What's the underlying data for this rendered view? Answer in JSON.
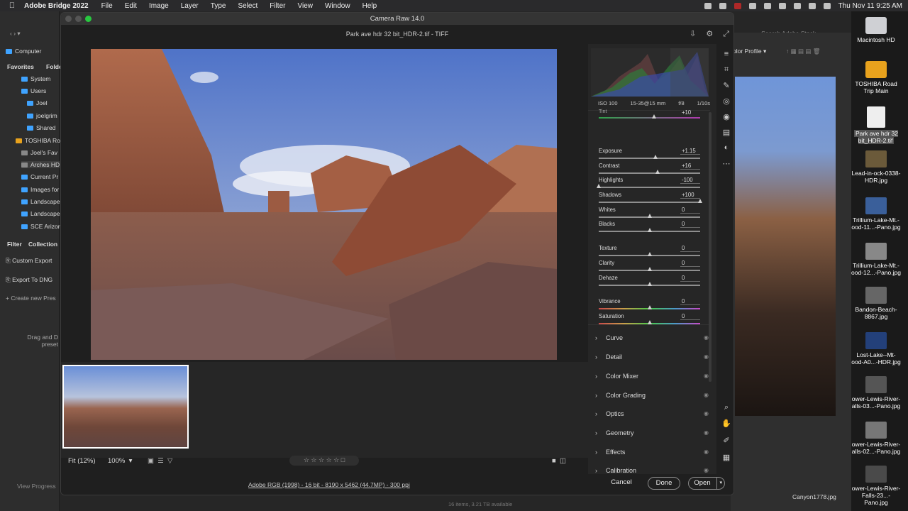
{
  "menubar": {
    "apple": "",
    "app": "Adobe Bridge 2022",
    "items": [
      "File",
      "Edit",
      "Image",
      "Layer",
      "Type",
      "Select",
      "Filter",
      "View",
      "Window",
      "Help"
    ],
    "clock": "Thu Nov 11  9:25 AM"
  },
  "bridge": {
    "path": "Computer",
    "tabs": [
      "Favorites",
      "Folde"
    ],
    "tree": [
      "System",
      "Users",
      "Joel",
      "joelgrim",
      "Shared",
      "TOSHIBA Roa",
      "Joel's Fav",
      "Arches HD",
      "Current Pr",
      "Images for",
      "Landscape",
      "Landscape",
      "SCE Arizor"
    ],
    "bottom_tabs": [
      "Filter",
      "Collection"
    ],
    "export_items": [
      "Custom Export",
      "Export To DNG"
    ],
    "create_preset": "Create new Pres",
    "drag_hint": "Drag and D\npreset",
    "view_progress": "View Progress",
    "search_placeholder": "Search Adobe Stock",
    "color_profile": "olor Profile",
    "status": "16 items, 3.21 TB available",
    "canyon_file": "Canyon1778.jpg"
  },
  "desktop": {
    "icons": [
      {
        "label": "Macintosh HD"
      },
      {
        "label": "TOSHIBA Road Trip Main"
      },
      {
        "label": "Park ave hdr 32 bit_HDR-2.tif"
      },
      {
        "label": "Lead-in-ock-0338-HDR.jpg"
      },
      {
        "label": "Trillium-Lake-Mt.-ood-11...-Pano.jpg"
      },
      {
        "label": "Trillium-Lake-Mt.-ood-12...-Pano.jpg"
      },
      {
        "label": "Bandon-Beach-8867.jpg"
      },
      {
        "label": "Lost-Lake--Mt-ood-A0...-HDR.jpg"
      },
      {
        "label": "ower-Lewis-River-alls-03...-Pano.jpg"
      },
      {
        "label": "ower-Lewis-River-alls-02...-Pano.jpg"
      },
      {
        "label": "ower-Lewis-River-Falls-23...-Pano.jpg"
      }
    ]
  },
  "acr": {
    "window_title": "Camera Raw 14.0",
    "file_title": "Park ave hdr 32 bit_HDR-2.tif  -  TIFF",
    "meta": [
      "ISO 100",
      "15-35@15 mm",
      "f/8",
      "1/10s"
    ],
    "tint_label": "Tint",
    "tint_value": "+10",
    "sliders": [
      {
        "label": "Exposure",
        "value": "+1.15",
        "pos": 0.557
      },
      {
        "label": "Contrast",
        "value": "+16",
        "pos": 0.58
      },
      {
        "label": "Highlights",
        "value": "-100",
        "pos": 0.0
      },
      {
        "label": "Shadows",
        "value": "+100",
        "pos": 1.0
      },
      {
        "label": "Whites",
        "value": "0",
        "pos": 0.5
      },
      {
        "label": "Blacks",
        "value": "0",
        "pos": 0.5
      },
      {
        "label": "Texture",
        "value": "0",
        "pos": 0.5
      },
      {
        "label": "Clarity",
        "value": "0",
        "pos": 0.5
      },
      {
        "label": "Dehaze",
        "value": "0",
        "pos": 0.5
      },
      {
        "label": "Vibrance",
        "value": "0",
        "pos": 0.5
      },
      {
        "label": "Saturation",
        "value": "0",
        "pos": 0.5
      }
    ],
    "sections": [
      "Curve",
      "Detail",
      "Color Mixer",
      "Color Grading",
      "Optics",
      "Geometry",
      "Effects",
      "Calibration"
    ],
    "zoom_fit": "Fit (12%)",
    "zoom_100": "100%",
    "footer_link": "Adobe RGB (1998) - 16 bit - 8190 x 5462 (44.7MP) - 300 ppi",
    "buttons": {
      "cancel": "Cancel",
      "done": "Done",
      "open": "Open"
    }
  },
  "colors": {
    "accent": "#3fa3ff",
    "panel": "#262626",
    "bg": "#1f1f1f"
  }
}
